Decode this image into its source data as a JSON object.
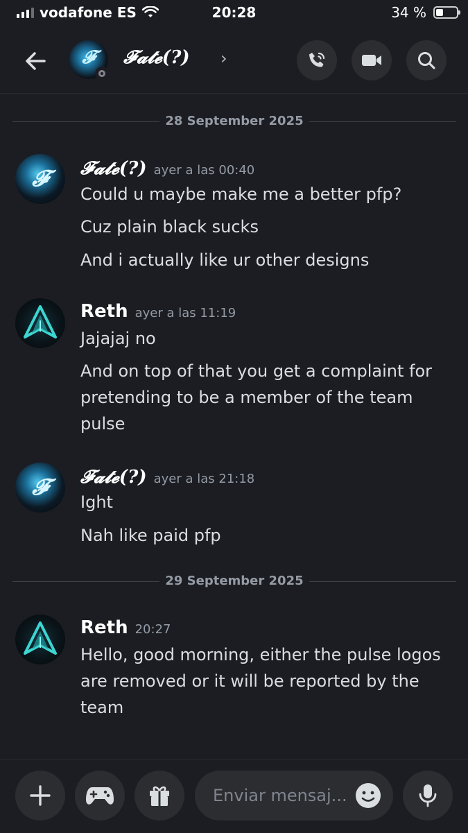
{
  "status_bar": {
    "carrier": "vodafone ES",
    "time": "20:28",
    "battery_percent_label": "34 %",
    "battery_level": 0.34
  },
  "header": {
    "contact_name": "𝓕𝓪𝓽𝓮(?)",
    "chevron": "›",
    "buttons": [
      "phone-call-icon",
      "video-camera-icon",
      "search-icon"
    ]
  },
  "date_separators": {
    "first": "28 September 2025",
    "second": "29 September 2025"
  },
  "messages": [
    {
      "author": "𝓕𝓪𝓽𝓮(?)",
      "time": "ayer a las 00:40",
      "lines": [
        "Could u maybe make me a better pfp?",
        "Cuz plain black sucks",
        "And i actually like ur other designs"
      ]
    },
    {
      "author": "Reth",
      "time": "ayer a las 11:19",
      "lines": [
        "Jajajaj no",
        "And on top of that you get a complaint for",
        "pretending to be a member of the team",
        "pulse"
      ]
    },
    {
      "author": "𝓕𝓪𝓽𝓮(?)",
      "time": "ayer a las 21:18",
      "lines": [
        "Ight",
        "Nah like paid pfp"
      ]
    },
    {
      "author": "Reth",
      "time": "20:27",
      "lines": [
        "Hello, good morning, either the pulse logos",
        "are removed or it will be reported by the",
        "team"
      ]
    }
  ],
  "composer": {
    "placeholder": "Enviar mensaj..."
  }
}
